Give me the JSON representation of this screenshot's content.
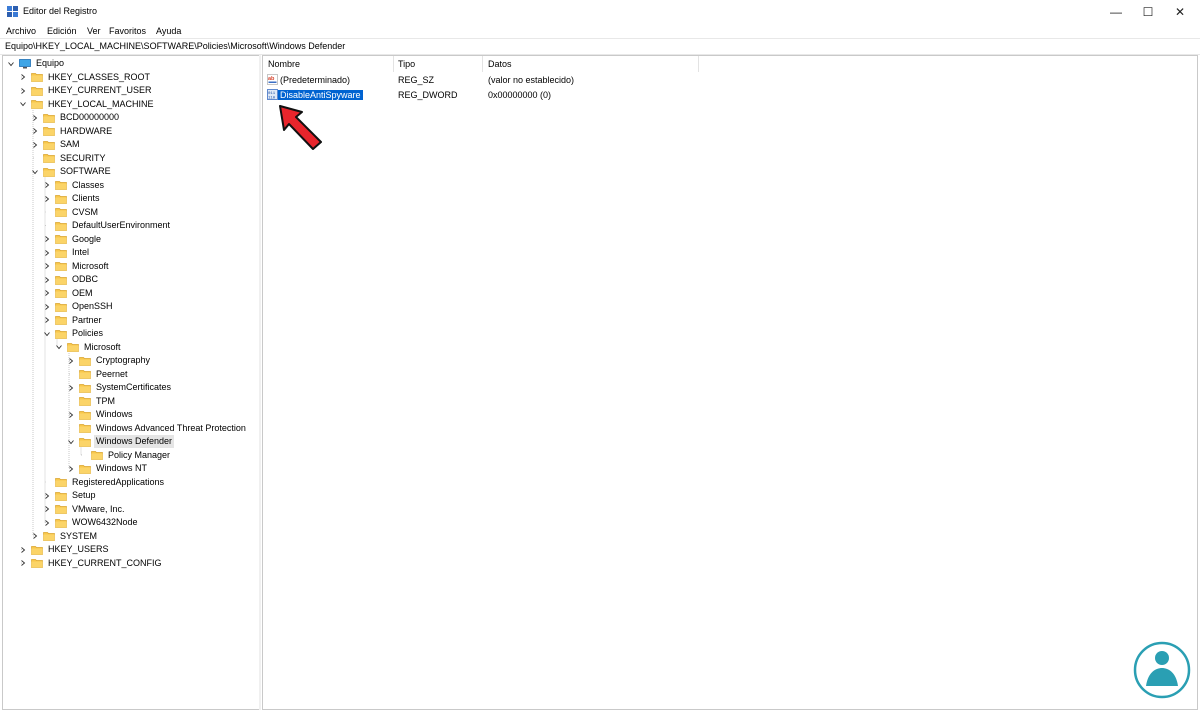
{
  "window": {
    "title": "Editor del Registro",
    "buttons": {
      "minimize": "—",
      "maximize": "☐",
      "close": "✕"
    }
  },
  "menu": {
    "items": [
      "Archivo",
      "Edición",
      "Ver",
      "Favoritos",
      "Ayuda"
    ]
  },
  "address": {
    "path": "Equipo\\HKEY_LOCAL_MACHINE\\SOFTWARE\\Policies\\Microsoft\\Windows Defender"
  },
  "tree": {
    "root": "Equipo",
    "nodes": [
      {
        "label": "HKEY_CLASSES_ROOT",
        "level": 1,
        "state": "collapsed"
      },
      {
        "label": "HKEY_CURRENT_USER",
        "level": 1,
        "state": "collapsed"
      },
      {
        "label": "HKEY_LOCAL_MACHINE",
        "level": 1,
        "state": "expanded"
      },
      {
        "label": "BCD00000000",
        "level": 2,
        "state": "collapsed"
      },
      {
        "label": "HARDWARE",
        "level": 2,
        "state": "collapsed"
      },
      {
        "label": "SAM",
        "level": 2,
        "state": "collapsed"
      },
      {
        "label": "SECURITY",
        "level": 2,
        "state": "none"
      },
      {
        "label": "SOFTWARE",
        "level": 2,
        "state": "expanded"
      },
      {
        "label": "Classes",
        "level": 3,
        "state": "collapsed"
      },
      {
        "label": "Clients",
        "level": 3,
        "state": "collapsed"
      },
      {
        "label": "CVSM",
        "level": 3,
        "state": "none"
      },
      {
        "label": "DefaultUserEnvironment",
        "level": 3,
        "state": "none"
      },
      {
        "label": "Google",
        "level": 3,
        "state": "collapsed"
      },
      {
        "label": "Intel",
        "level": 3,
        "state": "collapsed"
      },
      {
        "label": "Microsoft",
        "level": 3,
        "state": "collapsed"
      },
      {
        "label": "ODBC",
        "level": 3,
        "state": "collapsed"
      },
      {
        "label": "OEM",
        "level": 3,
        "state": "collapsed"
      },
      {
        "label": "OpenSSH",
        "level": 3,
        "state": "collapsed"
      },
      {
        "label": "Partner",
        "level": 3,
        "state": "collapsed"
      },
      {
        "label": "Policies",
        "level": 3,
        "state": "expanded"
      },
      {
        "label": "Microsoft",
        "level": 4,
        "state": "expanded"
      },
      {
        "label": "Cryptography",
        "level": 5,
        "state": "collapsed"
      },
      {
        "label": "Peernet",
        "level": 5,
        "state": "none"
      },
      {
        "label": "SystemCertificates",
        "level": 5,
        "state": "collapsed"
      },
      {
        "label": "TPM",
        "level": 5,
        "state": "none"
      },
      {
        "label": "Windows",
        "level": 5,
        "state": "collapsed"
      },
      {
        "label": "Windows Advanced Threat Protection",
        "level": 5,
        "state": "none"
      },
      {
        "label": "Windows Defender",
        "level": 5,
        "state": "expanded",
        "selected": true
      },
      {
        "label": "Policy Manager",
        "level": 6,
        "state": "none"
      },
      {
        "label": "Windows NT",
        "level": 5,
        "state": "collapsed"
      },
      {
        "label": "RegisteredApplications",
        "level": 3,
        "state": "none"
      },
      {
        "label": "Setup",
        "level": 3,
        "state": "collapsed"
      },
      {
        "label": "VMware, Inc.",
        "level": 3,
        "state": "collapsed"
      },
      {
        "label": "WOW6432Node",
        "level": 3,
        "state": "collapsed"
      },
      {
        "label": "SYSTEM",
        "level": 2,
        "state": "collapsed"
      },
      {
        "label": "HKEY_USERS",
        "level": 1,
        "state": "collapsed"
      },
      {
        "label": "HKEY_CURRENT_CONFIG",
        "level": 1,
        "state": "collapsed"
      }
    ]
  },
  "list": {
    "columns": [
      "Nombre",
      "Tipo",
      "Datos"
    ],
    "rows": [
      {
        "name": "(Predeterminado)",
        "type": "REG_SZ",
        "data": "(valor no establecido)",
        "icon": "string-value-icon"
      },
      {
        "name": "DisableAntiSpyware",
        "type": "REG_DWORD",
        "data": "0x00000000 (0)",
        "icon": "binary-value-icon",
        "selected": true
      }
    ]
  },
  "colors": {
    "selection": "#0063d1",
    "folder": "#f8c74a",
    "annotation_arrow": "#e8252c",
    "logo": "#2a9fb3"
  }
}
